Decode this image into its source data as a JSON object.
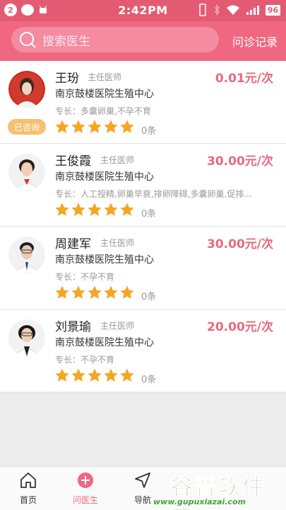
{
  "statusbar": {
    "badge": "2",
    "time": "2:42PM",
    "battery": "96"
  },
  "header": {
    "search_placeholder": "搜索医生",
    "records": "问诊记录"
  },
  "doctors": [
    {
      "name": "王玢",
      "title": "主任医师",
      "price": "0.01元/次",
      "hospital": "南京鼓楼医院生殖中心",
      "specialty": "专长：多囊卵巢,不孕不育",
      "rating": 5,
      "count": "0条",
      "consulted": "已咨询"
    },
    {
      "name": "王俊霞",
      "title": "主任医师",
      "price": "30.00元/次",
      "hospital": "南京鼓楼医院生殖中心",
      "specialty": "专长：人工授精,卵巢早衰,排卵障碍,多囊卵巢,促排...",
      "rating": 5,
      "count": "0条"
    },
    {
      "name": "周建军",
      "title": "主任医师",
      "price": "30.00元/次",
      "hospital": "南京鼓楼医院生殖中心",
      "specialty": "专长：不孕不育",
      "rating": 5,
      "count": "0条"
    },
    {
      "name": "刘景瑜",
      "title": "主任医师",
      "price": "20.00元/次",
      "hospital": "南京鼓楼医院生殖中心",
      "specialty": "专长：不孕不育",
      "rating": 5,
      "count": "0条"
    }
  ],
  "nav": {
    "home": "首页",
    "ask": "问医生",
    "navi": "导航"
  },
  "watermark": {
    "brand": "谷普软件园",
    "url": "www.gupuxiazai.com"
  },
  "colors": {
    "primary": "#ef6781",
    "star": "#f5a623",
    "price": "#e86a7e"
  }
}
